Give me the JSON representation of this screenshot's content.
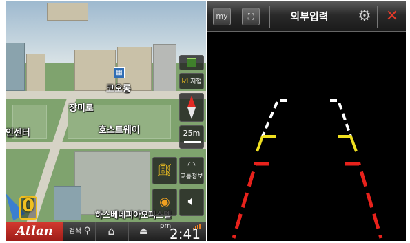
{
  "navigation": {
    "map_labels": {
      "poi_name": "코오롱",
      "street": "장미로",
      "building": "호스트웨이",
      "left_label": "인센터",
      "bottom_label": "하스베네피아오피스텔"
    },
    "side_buttons": {
      "layer_toggle": "지형",
      "scale": "25m",
      "traffic": "교통정보"
    },
    "speed": "0",
    "bottom_bar": {
      "brand": "Atlan",
      "search_label": "검색",
      "ampm": "pm",
      "time": "2:41"
    }
  },
  "camera": {
    "header": {
      "my_label": "my",
      "title": "외부입력"
    },
    "colors": {
      "white_line": "#ffffff",
      "yellow_line": "#f0e020",
      "red_line": "#e8221c",
      "close_x": "#e23a2a"
    }
  }
}
